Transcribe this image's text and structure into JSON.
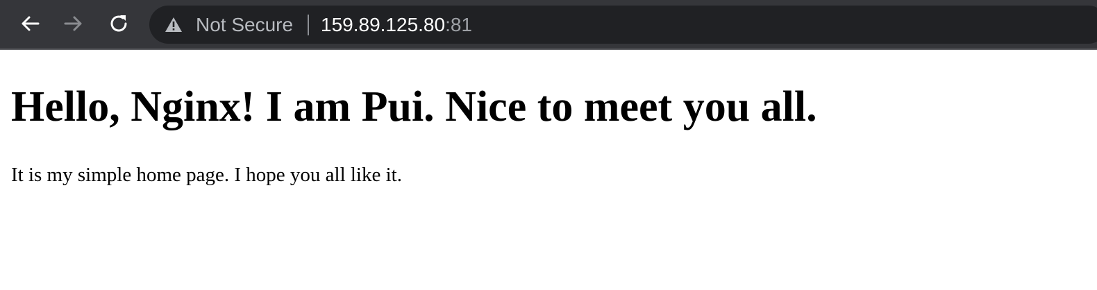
{
  "browser": {
    "navigation": {
      "back_icon": "back-arrow-icon",
      "forward_icon": "forward-arrow-icon",
      "reload_icon": "reload-icon",
      "forward_disabled": true
    },
    "address_bar": {
      "security_icon": "warning-icon",
      "security_label": "Not Secure",
      "url_host": "159.89.125.80",
      "url_port": ":81"
    }
  },
  "page": {
    "heading": "Hello, Nginx! I am Pui. Nice to meet you all.",
    "paragraph": "It is my simple home page. I hope you all like it."
  },
  "colors": {
    "toolbar": "#35363a",
    "omnibox": "#202124",
    "text_primary": "#ffffff",
    "text_secondary": "#b8bbc0"
  }
}
